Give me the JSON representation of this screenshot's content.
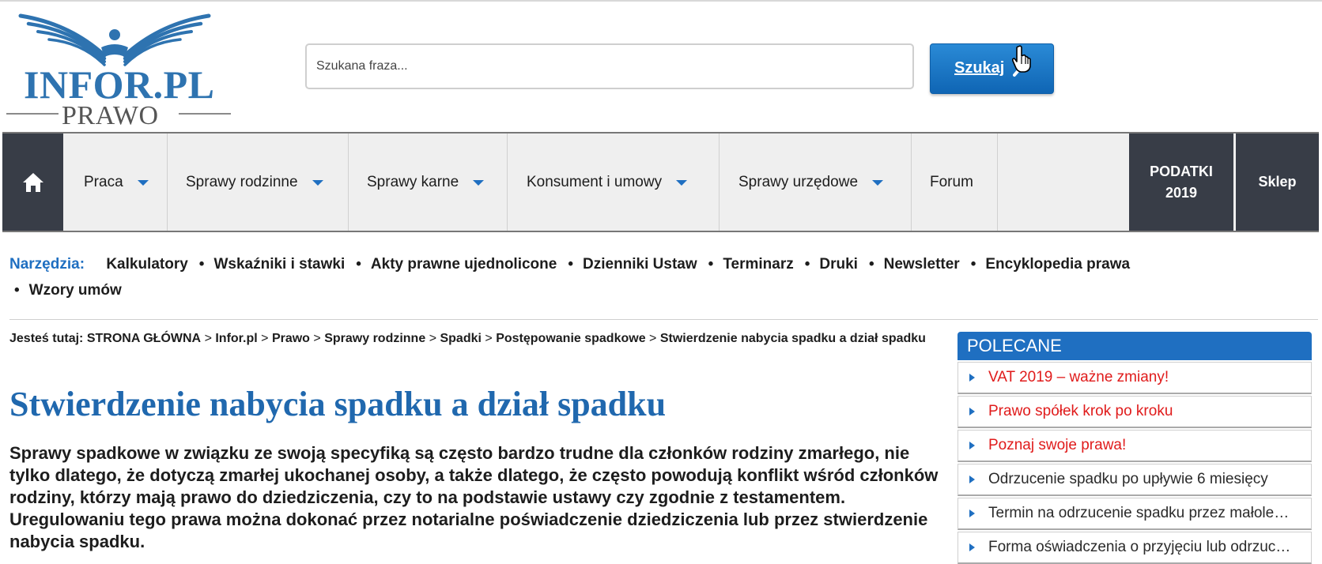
{
  "header": {
    "logo_text": "INFOR.PL",
    "logo_sub": "PRAWO",
    "search_placeholder": "Szukana fraza...",
    "search_button": "Szukaj",
    "colors": {
      "brand_blue": "#2e73b0",
      "button_blue": "#1573c5",
      "nav_dark": "#383d47",
      "link_red": "#e01b1b"
    }
  },
  "nav": {
    "home_icon": "home-icon",
    "items": [
      {
        "label": "Praca",
        "dropdown": true
      },
      {
        "label": "Sprawy rodzinne",
        "dropdown": true
      },
      {
        "label": "Sprawy karne",
        "dropdown": true
      },
      {
        "label": "Konsument i umowy",
        "dropdown": true
      },
      {
        "label": "Sprawy urzędowe",
        "dropdown": true
      },
      {
        "label": "Forum",
        "dropdown": false
      }
    ],
    "podatki_line1": "PODATKI",
    "podatki_line2": "2019",
    "sklep": "Sklep"
  },
  "tools": {
    "label": "Narzędzia:",
    "items": [
      "Kalkulatory",
      "Wskaźniki i stawki",
      "Akty prawne ujednolicone",
      "Dzienniki Ustaw",
      "Terminarz",
      "Druki",
      "Newsletter",
      "Encyklopedia prawa",
      "Wzory umów"
    ]
  },
  "breadcrumb": {
    "lead": "Jesteś tutaj:",
    "items": [
      "STRONA GŁÓWNA",
      "Infor.pl",
      "Prawo",
      "Sprawy rodzinne",
      "Spadki",
      "Postępowanie spadkowe",
      "Stwierdzenie nabycia spadku a dział spadku"
    ],
    "separator": ">"
  },
  "article": {
    "title": "Stwierdzenie nabycia spadku a dział spadku",
    "lead": "Sprawy spadkowe w związku ze swoją specyfiką są często bardzo trudne dla członków rodziny zmarłego, nie tylko dlatego, że dotyczą zmarłej ukochanej osoby, a także dlatego, że często powodują konflikt wśród członków rodziny, którzy mają prawo do dziedziczenia, czy to na podstawie ustawy czy zgodnie z testamentem. Uregulowaniu tego prawa można dokonać przez notarialne poświadczenie dziedziczenia lub przez stwierdzenie nabycia spadku."
  },
  "sidebar": {
    "title": "POLECANE",
    "items": [
      {
        "label": "VAT 2019 – ważne zmiany!",
        "color": "red"
      },
      {
        "label": "Prawo spółek krok po kroku",
        "color": "red"
      },
      {
        "label": "Poznaj swoje prawa!",
        "color": "red"
      },
      {
        "label": "Odrzucenie spadku po upływie 6 miesięcy",
        "color": "dark"
      },
      {
        "label": "Termin na odrzucenie spadku przez małoletniego",
        "color": "dark"
      },
      {
        "label": "Forma oświadczenia o przyjęciu lub odrzuceniu spadku",
        "color": "dark"
      }
    ]
  }
}
